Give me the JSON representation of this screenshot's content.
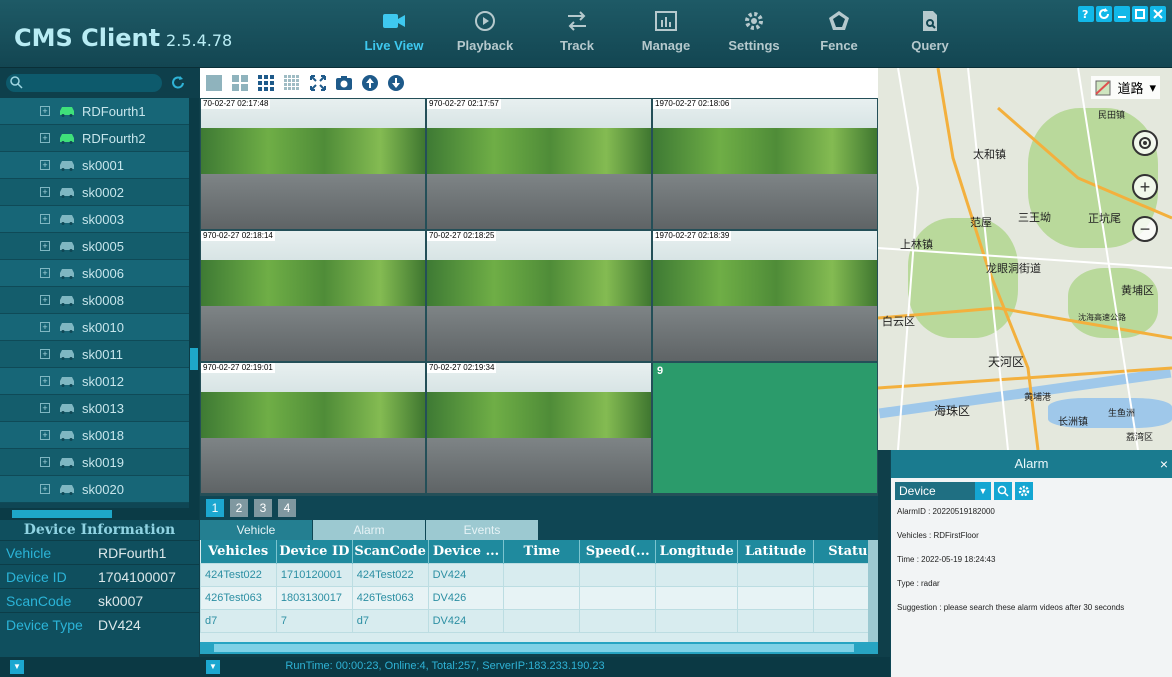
{
  "header": {
    "title": "CMS Client",
    "version": "2.5.4.78",
    "nav": [
      {
        "label": "Live View",
        "icon": "camera-icon",
        "active": true
      },
      {
        "label": "Playback",
        "icon": "playback-icon",
        "active": false
      },
      {
        "label": "Track",
        "icon": "track-icon",
        "active": false
      },
      {
        "label": "Manage",
        "icon": "manage-icon",
        "active": false
      },
      {
        "label": "Settings",
        "icon": "gear-icon",
        "active": false
      },
      {
        "label": "Fence",
        "icon": "fence-icon",
        "active": false
      },
      {
        "label": "Query",
        "icon": "query-icon",
        "active": false
      }
    ],
    "window_buttons": [
      "help-icon",
      "refresh-icon",
      "minimize-icon",
      "maximize-icon",
      "close-icon"
    ]
  },
  "sidebar": {
    "search": {
      "placeholder": ""
    },
    "devices": [
      {
        "name": "RDFourth1",
        "online": true
      },
      {
        "name": "RDFourth2",
        "online": true
      },
      {
        "name": "sk0001",
        "online": false
      },
      {
        "name": "sk0002",
        "online": false
      },
      {
        "name": "sk0003",
        "online": false
      },
      {
        "name": "sk0005",
        "online": false
      },
      {
        "name": "sk0006",
        "online": false
      },
      {
        "name": "sk0008",
        "online": false
      },
      {
        "name": "sk0010",
        "online": false
      },
      {
        "name": "sk0011",
        "online": false
      },
      {
        "name": "sk0012",
        "online": false
      },
      {
        "name": "sk0013",
        "online": false
      },
      {
        "name": "sk0018",
        "online": false
      },
      {
        "name": "sk0019",
        "online": false
      },
      {
        "name": "sk0020",
        "online": false
      }
    ]
  },
  "device_info": {
    "title": "Device Information",
    "rows": [
      {
        "key": "Vehicle",
        "value": "RDFourth1"
      },
      {
        "key": "Device ID",
        "value": "1704100007"
      },
      {
        "key": "ScanCode",
        "value": "sk0007"
      },
      {
        "key": "Device Type",
        "value": "DV424"
      }
    ]
  },
  "videos": {
    "tiles": [
      {
        "timestamp": "70-02-27 02:17:48",
        "selected": true
      },
      {
        "timestamp": "970-02-27 02:17:57",
        "selected": false
      },
      {
        "timestamp": "1970-02-27 02:18:06",
        "selected": false
      },
      {
        "timestamp": "970-02-27 02:18:14",
        "selected": false
      },
      {
        "timestamp": "70-02-27 02:18:25",
        "selected": false
      },
      {
        "timestamp": "1970-02-27 02:18:39",
        "selected": false
      },
      {
        "timestamp": "970-02-27 02:19:01",
        "selected": false
      },
      {
        "timestamp": "70-02-27 02:19:34",
        "selected": false
      }
    ],
    "empty_tile_label": "9",
    "pages": [
      "1",
      "2",
      "3",
      "4"
    ]
  },
  "bottom_tabs": [
    "Vehicle",
    "Alarm",
    "Events"
  ],
  "table": {
    "columns": [
      "Vehicles",
      "Device ID",
      "ScanCode",
      "Device ...",
      "Time",
      "Speed(...",
      "Longitude",
      "Latitude",
      "Status"
    ],
    "rows": [
      [
        "424Test022",
        "1710120001",
        "424Test022",
        "DV424",
        "",
        "",
        "",
        "",
        ""
      ],
      [
        "426Test063",
        "1803130017",
        "426Test063",
        "DV426",
        "",
        "",
        "",
        "",
        ""
      ],
      [
        "d7",
        "7",
        "d7",
        "DV424",
        "",
        "",
        "",
        "",
        ""
      ]
    ]
  },
  "status_bar": {
    "text": "RunTime: 00:00:23, Online:4, Total:257, ServerIP:183.233.190.23"
  },
  "map": {
    "type_label": "道路",
    "labels": [
      "民田镇",
      "太和镇",
      "三王坳",
      "范屋",
      "正坑尾",
      "上林镇",
      "龙眼洞街道",
      "黄埔区",
      "白云区",
      "沈海高速公路",
      "天河区",
      "海珠区",
      "长洲镇",
      "黄埔港",
      "生鱼洲",
      "荔湾区"
    ]
  },
  "alarm": {
    "title": "Alarm",
    "filter_value": "Device",
    "lines": [
      "AlarmID : 20220519182000",
      "Vehicles : RDFirstFloor",
      "Time : 2022-05-19 18:24:43",
      "Type : radar",
      "Suggestion : please search these alarm videos after 30 seconds"
    ]
  },
  "colors": {
    "accent": "#12b8e8",
    "header_bg": "#134652",
    "active_nav": "#3ec8ef",
    "online_car": "#3fe07a"
  }
}
